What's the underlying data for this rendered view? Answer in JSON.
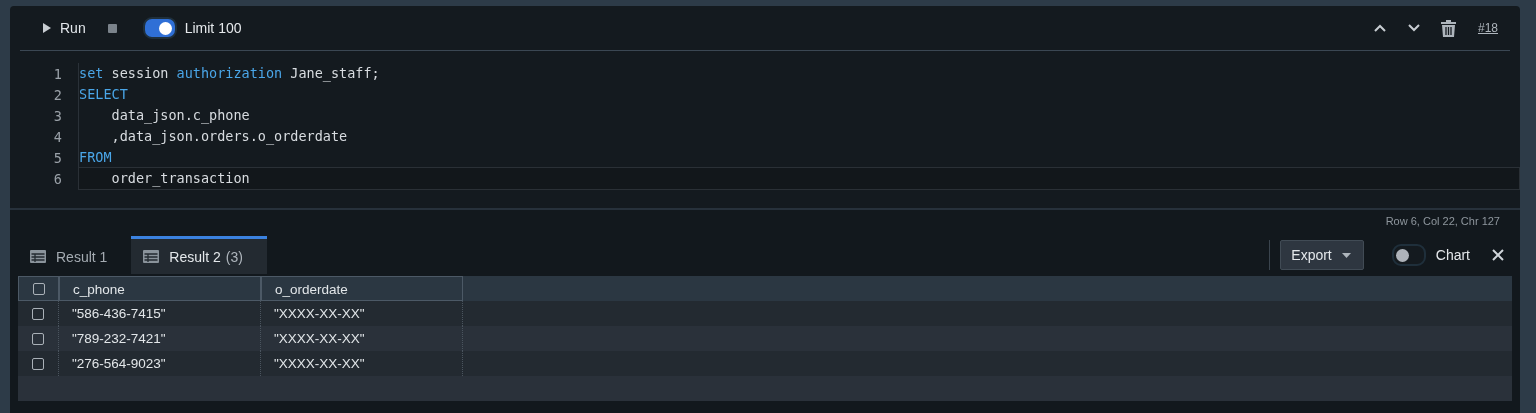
{
  "toolbar": {
    "run_label": "Run",
    "limit": {
      "label": "Limit 100",
      "on": true
    },
    "query_number": "#18"
  },
  "editor": {
    "lines": [
      {
        "number": "1",
        "current": false,
        "tokens": [
          {
            "text": "set",
            "kind": "keyword"
          },
          {
            "text": " session ",
            "kind": "plain"
          },
          {
            "text": "authorization",
            "kind": "keyword"
          },
          {
            "text": " Jane_staff;",
            "kind": "plain"
          }
        ]
      },
      {
        "number": "2",
        "current": false,
        "tokens": [
          {
            "text": "SELECT",
            "kind": "keyword"
          }
        ]
      },
      {
        "number": "3",
        "current": false,
        "tokens": [
          {
            "text": "    data_json.c_phone",
            "kind": "plain"
          }
        ]
      },
      {
        "number": "4",
        "current": false,
        "tokens": [
          {
            "text": "    ,data_json.orders.o_orderdate",
            "kind": "plain"
          }
        ]
      },
      {
        "number": "5",
        "current": false,
        "tokens": [
          {
            "text": "FROM",
            "kind": "keyword"
          }
        ]
      },
      {
        "number": "6",
        "current": true,
        "tokens": [
          {
            "text": "    order_transaction",
            "kind": "plain"
          }
        ]
      }
    ]
  },
  "cursor_status": "Row 6,  Col 22,  Chr 127",
  "result_tabs": [
    {
      "label": "Result 1",
      "selected": false
    },
    {
      "label": "Result 2",
      "count": "(3)",
      "selected": true
    }
  ],
  "export_label": "Export",
  "chart_toggle": {
    "label": "Chart",
    "on": false
  },
  "table": {
    "select_all_checked": false,
    "columns": [
      "c_phone",
      "o_orderdate"
    ],
    "rows": [
      {
        "checked": false,
        "cells": [
          "\"586-436-7415\"",
          "\"XXXX-XX-XX\""
        ]
      },
      {
        "checked": false,
        "cells": [
          "\"789-232-7421\"",
          "\"XXXX-XX-XX\""
        ]
      },
      {
        "checked": false,
        "cells": [
          "\"276-564-9023\"",
          "\"XXXX-XX-XX\""
        ]
      }
    ]
  }
}
